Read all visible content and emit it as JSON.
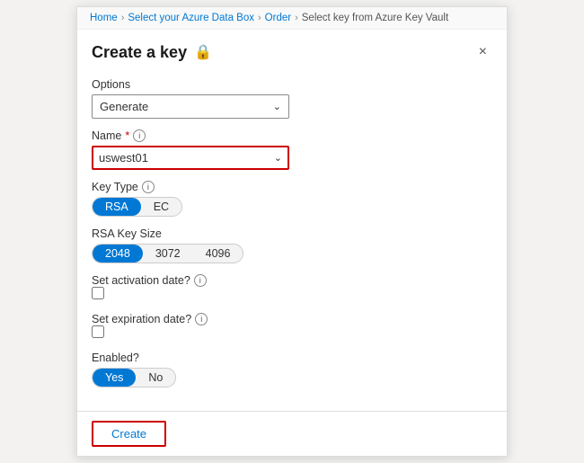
{
  "breadcrumb": {
    "items": [
      {
        "label": "Home",
        "active": true
      },
      {
        "label": "Select your Azure Data Box",
        "active": true
      },
      {
        "label": "Order",
        "active": true
      },
      {
        "label": "Select key from Azure Key Vault",
        "active": false
      }
    ],
    "separator": ">"
  },
  "modal": {
    "title": "Create a key",
    "close_label": "×",
    "lock_icon": "🔒"
  },
  "form": {
    "options_label": "Options",
    "options_value": "Generate",
    "options_chevron": "⌄",
    "name_label": "Name",
    "name_required": "*",
    "name_info": "i",
    "name_value": "uswest01",
    "name_chevron": "⌄",
    "key_type_label": "Key Type",
    "key_type_info": "i",
    "key_type_options": [
      {
        "label": "RSA",
        "active": true
      },
      {
        "label": "EC",
        "active": false
      }
    ],
    "rsa_size_label": "RSA Key Size",
    "rsa_size_options": [
      {
        "label": "2048",
        "active": true
      },
      {
        "label": "3072",
        "active": false
      },
      {
        "label": "4096",
        "active": false
      }
    ],
    "activation_label": "Set activation date?",
    "activation_info": "i",
    "activation_checked": false,
    "expiration_label": "Set expiration date?",
    "expiration_info": "i",
    "expiration_checked": false,
    "enabled_label": "Enabled?",
    "enabled_options": [
      {
        "label": "Yes",
        "active": true
      },
      {
        "label": "No",
        "active": false
      }
    ]
  },
  "footer": {
    "create_label": "Create"
  }
}
